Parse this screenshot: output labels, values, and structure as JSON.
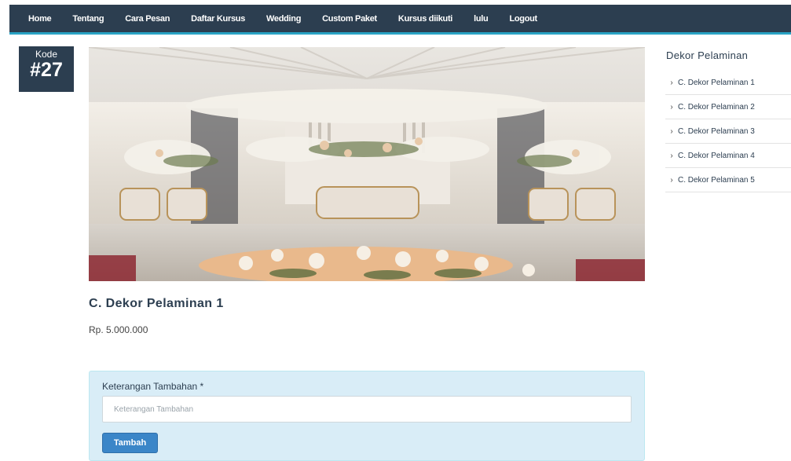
{
  "nav": {
    "items": [
      "Home",
      "Tentang",
      "Cara Pesan",
      "Daftar Kursus",
      "Wedding",
      "Custom Paket",
      "Kursus diikuti",
      "lulu",
      "Logout"
    ]
  },
  "badge": {
    "label": "Kode",
    "number": "#27"
  },
  "product": {
    "title": "C. Dekor Pelaminan 1",
    "price": "Rp. 5.000.000"
  },
  "form": {
    "label": "Keterangan Tambahan *",
    "placeholder": "Keterangan Tambahan",
    "value": "",
    "submit_label": "Tambah"
  },
  "sidebar": {
    "title": "Dekor Pelaminan",
    "items": [
      {
        "label": "C. Dekor Pelaminan 1",
        "icon": "chevron-right-icon"
      },
      {
        "label": "C. Dekor Pelaminan 2",
        "icon": "chevron-right-icon"
      },
      {
        "label": "C. Dekor Pelaminan 3",
        "icon": "chevron-right-icon"
      },
      {
        "label": "C. Dekor Pelaminan 4",
        "icon": "chevron-right-icon"
      },
      {
        "label": "C. Dekor Pelaminan 5",
        "icon": "chevron-right-icon"
      }
    ]
  },
  "colors": {
    "navbar": "#2c3e50",
    "navbar_accent": "#2aa3c4",
    "panel": "#d9edf7",
    "button": "#3b86c8"
  }
}
